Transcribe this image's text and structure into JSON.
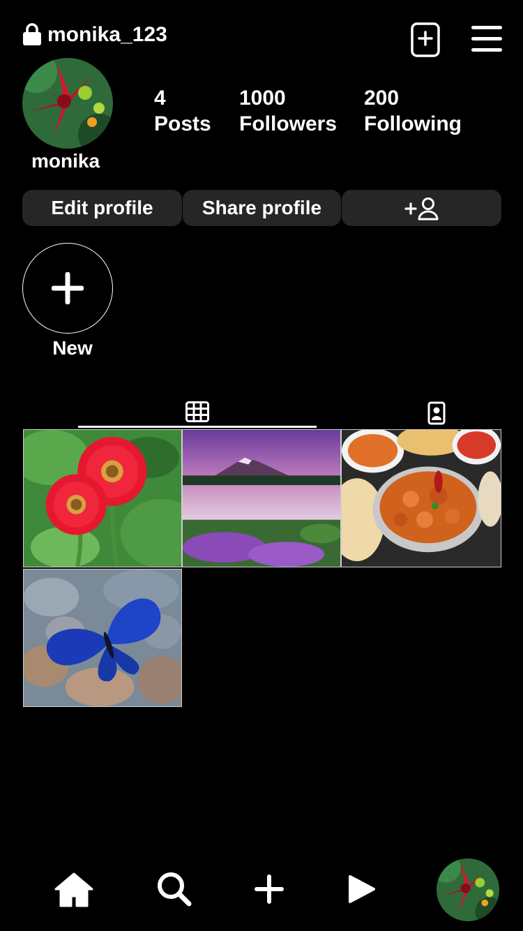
{
  "header": {
    "username": "monika_123",
    "lock_icon": "lock-icon",
    "new_post_icon": "plus-square-icon",
    "menu_icon": "hamburger-menu-icon"
  },
  "profile": {
    "display_name": "monika",
    "avatar_icon": "red-lily-photo",
    "stats": [
      {
        "count": "4",
        "label": "Posts"
      },
      {
        "count": "1000",
        "label": "Followers"
      },
      {
        "count": "200",
        "label": "Following"
      }
    ]
  },
  "actions": {
    "edit_label": "Edit profile",
    "share_label": "Share profile",
    "add_person_icon": "add-person-icon"
  },
  "highlights": {
    "new_label": "New",
    "new_icon": "plus-icon"
  },
  "tabs": {
    "active": "grid",
    "grid_icon": "grid-icon",
    "tagged_icon": "tagged-person-icon"
  },
  "posts": [
    {
      "subject": "red-gerbera-flowers"
    },
    {
      "subject": "mountain-lake-sunset"
    },
    {
      "subject": "curry-dishes"
    },
    {
      "subject": "blue-butterfly-on-rocks"
    }
  ],
  "bottom_nav": {
    "home_icon": "home-icon",
    "search_icon": "search-icon",
    "create_icon": "plus-icon",
    "reels_icon": "play-icon",
    "profile_icon": "avatar"
  },
  "colors": {
    "background": "#000000",
    "text": "#ffffff",
    "button_bg": "#262626"
  }
}
